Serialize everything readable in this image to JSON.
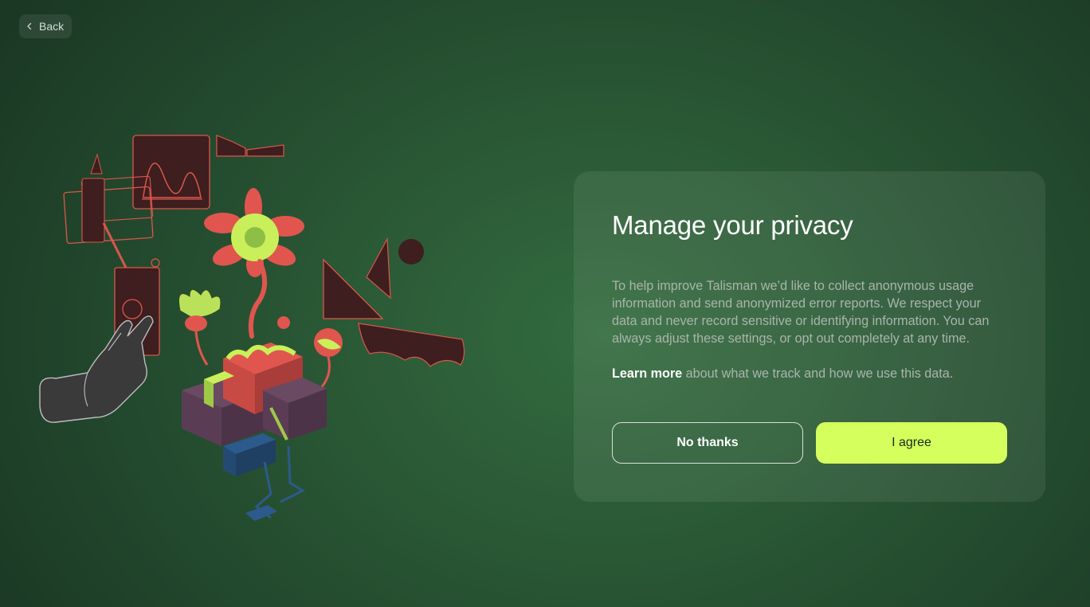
{
  "nav": {
    "back_label": "Back"
  },
  "privacy": {
    "title": "Manage your privacy",
    "body": "To help improve Talisman we’d like to collect anonymous usage information and send anonymized error reports. We respect your data and never record sensitive or identifying information. You can always adjust these settings, or opt out completely at any time.",
    "learn_more_link": "Learn more",
    "learn_more_rest": " about what we track and how we use this data.",
    "decline_label": "No thanks",
    "accept_label": "I agree"
  },
  "colors": {
    "accent": "#d5ff5c",
    "illustration_red": "#e0564e",
    "illustration_dark_red": "#3e1e1e",
    "illustration_lime": "#c9f05a",
    "illustration_purple": "#5a3d55",
    "illustration_blue": "#2d5a8c"
  }
}
